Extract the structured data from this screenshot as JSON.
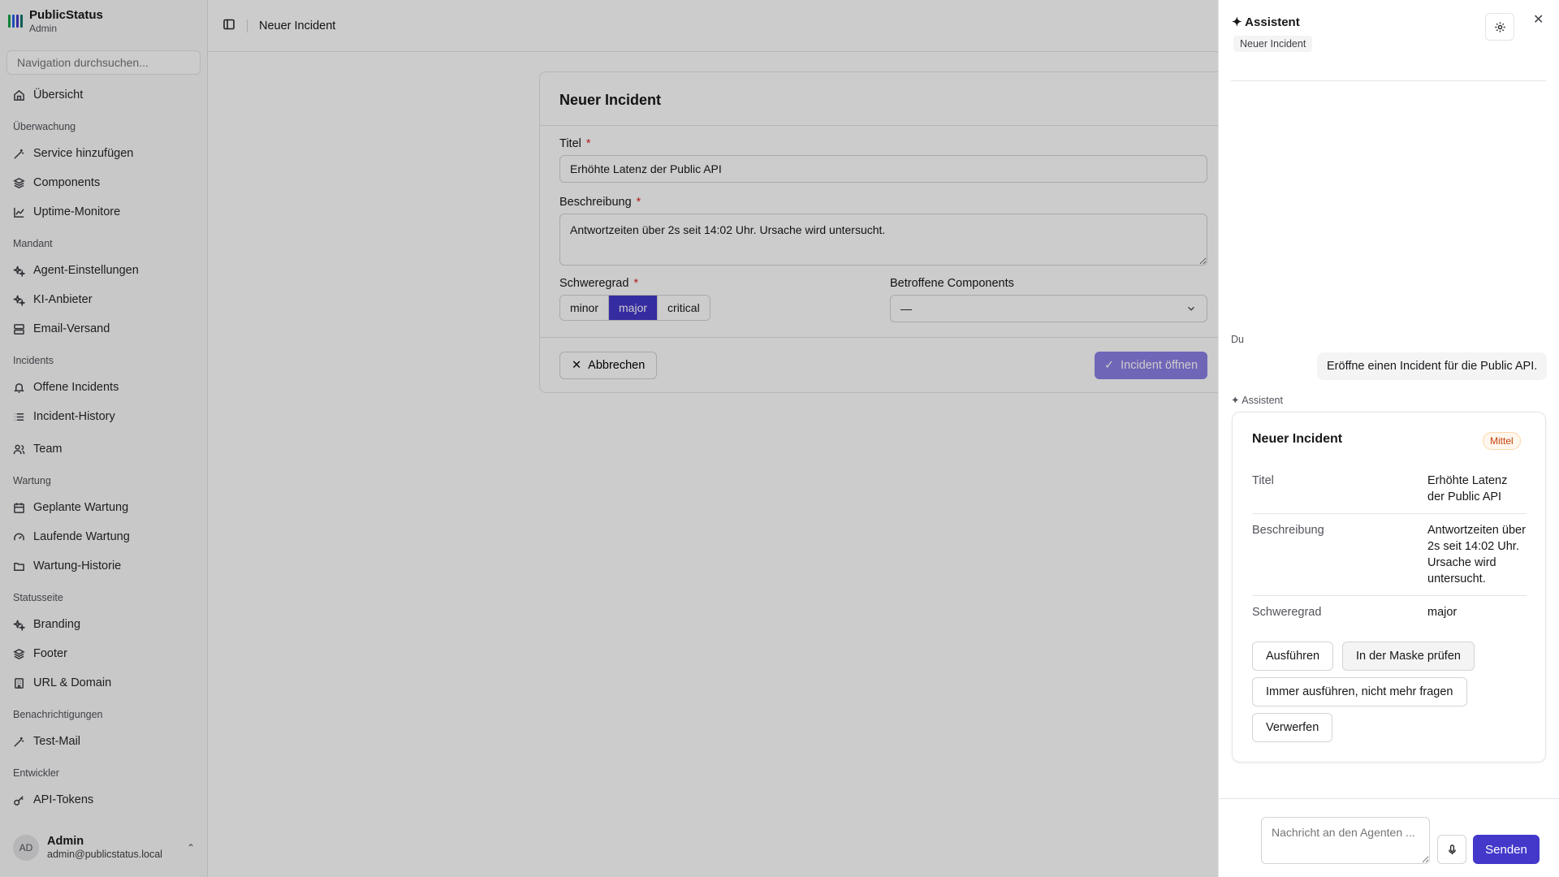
{
  "brand": {
    "name": "PublicStatus",
    "subtitle": "Admin",
    "logo_colors": [
      "#16a34a",
      "#2563eb",
      "#4338ca",
      "#0f766e"
    ]
  },
  "sidebar": {
    "search_placeholder": "Navigation durchsuchen...",
    "overview": "Übersicht",
    "groups": {
      "monitoring": "Überwachung",
      "tenant": "Mandant",
      "incidents": "Incidents",
      "maintenance": "Wartung",
      "statuspage": "Statusseite",
      "notifications": "Benachrichtigungen",
      "developer": "Entwickler"
    },
    "items": {
      "add_service": "Service hinzufügen",
      "components": "Components",
      "uptime": "Uptime-Monitore",
      "agent_settings": "Agent-Einstellungen",
      "ai_provider": "KI-Anbieter",
      "email": "Email-Versand",
      "open_incidents": "Offene Incidents",
      "incident_history": "Incident-History",
      "team": "Team",
      "planned": "Geplante Wartung",
      "running": "Laufende Wartung",
      "history": "Wartung-Historie",
      "branding": "Branding",
      "footer": "Footer",
      "url_domain": "URL & Domain",
      "test_mail": "Test-Mail",
      "api_tokens": "API-Tokens"
    },
    "user": {
      "initials": "AD",
      "name": "Admin",
      "email": "admin@publicstatus.local"
    }
  },
  "topbar": {
    "breadcrumb": "Neuer Incident"
  },
  "form": {
    "title": "Neuer Incident",
    "title_label": "Titel",
    "title_value": "Erhöhte Latenz der Public API",
    "desc_label": "Beschreibung",
    "desc_value": "Antwortzeiten über 2s seit 14:02 Uhr. Ursache wird untersucht.",
    "severity_label": "Schweregrad",
    "severity_options": [
      "minor",
      "major",
      "critical"
    ],
    "severity_selected": "major",
    "components_label": "Betroffene Components",
    "components_value": "—",
    "required_mark": "*",
    "cancel": "Abbrechen",
    "submit": "Incident öffnen"
  },
  "assistant": {
    "title": "✦ Assistent",
    "context_chip": "Neuer Incident",
    "user_label": "Du",
    "user_message": "Eröffne einen Incident für die Public API.",
    "assistant_label": "✦ Assistent",
    "proposal": {
      "title": "Neuer Incident",
      "badge": "Mittel",
      "rows": [
        {
          "key": "Titel",
          "value": "Erhöhte Latenz der Public API"
        },
        {
          "key": "Beschreibung",
          "value": "Antwortzeiten über 2s seit 14:02 Uhr. Ursache wird untersucht."
        },
        {
          "key": "Schweregrad",
          "value": "major"
        }
      ],
      "buttons": {
        "run": "Ausführen",
        "check": "In der Maske prüfen",
        "always": "Immer ausführen, nicht mehr fragen",
        "discard": "Verwerfen"
      }
    },
    "composer_placeholder": "Nachricht an den Agenten ...",
    "send": "Senden"
  }
}
